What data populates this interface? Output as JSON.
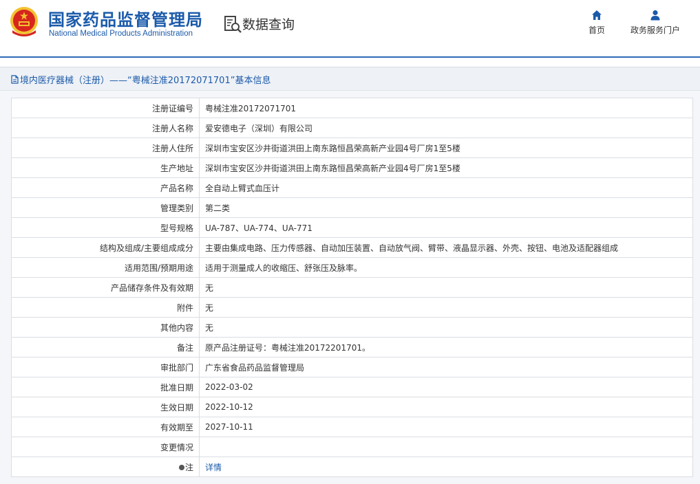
{
  "header": {
    "site_name_cn": "国家药品监督管理局",
    "site_name_en": "National Medical Products Administration",
    "query_title": "数据查询",
    "nav": [
      {
        "label": "首页",
        "icon": "home-icon"
      },
      {
        "label": "政务服务门户",
        "icon": "user-icon"
      }
    ]
  },
  "panel": {
    "title": "境内医疗器械（注册）——“粤械注准20172071701”基本信息"
  },
  "rows": [
    {
      "label": "注册证编号",
      "value": "粤械注准20172071701"
    },
    {
      "label": "注册人名称",
      "value": "爱安德电子（深圳）有限公司"
    },
    {
      "label": "注册人住所",
      "value": "深圳市宝安区沙井街道洪田上南东路恒昌荣高新产业园4号厂房1至5楼"
    },
    {
      "label": "生产地址",
      "value": "深圳市宝安区沙井街道洪田上南东路恒昌荣高新产业园4号厂房1至5楼"
    },
    {
      "label": "产品名称",
      "value": "全自动上臂式血压计"
    },
    {
      "label": "管理类别",
      "value": "第二类"
    },
    {
      "label": "型号规格",
      "value": "UA-787、UA-774、UA-771"
    },
    {
      "label": "结构及组成/主要组成成分",
      "value": "主要由集成电路、压力传感器、自动加压装置、自动放气阀、臂带、液晶显示器、外壳、按钮、电池及适配器组成"
    },
    {
      "label": "适用范围/预期用途",
      "value": "适用于测量成人的收缩压、舒张压及脉率。"
    },
    {
      "label": "产品储存条件及有效期",
      "value": "无"
    },
    {
      "label": "附件",
      "value": "无"
    },
    {
      "label": "其他内容",
      "value": "无"
    },
    {
      "label": "备注",
      "value": "原产品注册证号：粤械注准20172201701。"
    },
    {
      "label": "审批部门",
      "value": "广东省食品药品监督管理局"
    },
    {
      "label": "批准日期",
      "value": "2022-03-02"
    },
    {
      "label": "生效日期",
      "value": "2022-10-12"
    },
    {
      "label": "有效期至",
      "value": "2027-10-11"
    },
    {
      "label": "变更情况",
      "value": ""
    }
  ],
  "note_row": {
    "label": "注",
    "link_text": "详情"
  },
  "colors": {
    "brand": "#1b5aaa",
    "header_line": "#2c6ab7",
    "emblem_red": "#d7261e",
    "emblem_gold": "#f2c230"
  }
}
